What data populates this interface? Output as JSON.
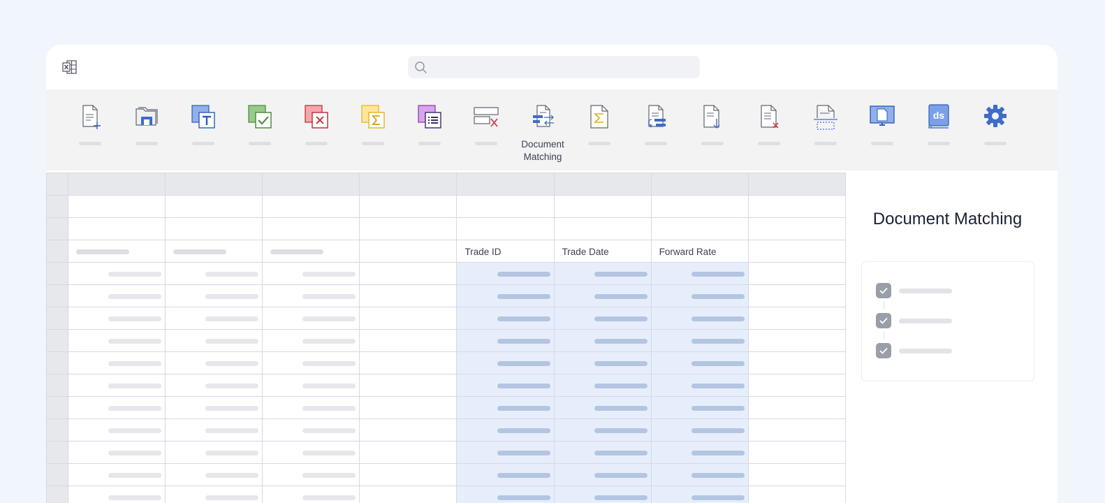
{
  "topbar": {
    "app_icon": "excel-icon",
    "search": {
      "placeholder": "",
      "value": "",
      "icon": "search-icon"
    }
  },
  "ribbon": {
    "items": [
      {
        "id": "new-document",
        "icon": "new-document-icon",
        "label": ""
      },
      {
        "id": "open-folder",
        "icon": "open-folder-icon",
        "label": ""
      },
      {
        "id": "text-template",
        "icon": "text-template-icon",
        "label": ""
      },
      {
        "id": "accept",
        "icon": "accept-check-icon",
        "label": ""
      },
      {
        "id": "reject",
        "icon": "reject-x-icon",
        "label": ""
      },
      {
        "id": "sum",
        "icon": "sigma-icon",
        "label": ""
      },
      {
        "id": "list",
        "icon": "list-icon",
        "label": ""
      },
      {
        "id": "remove-rows",
        "icon": "remove-rows-icon",
        "label": ""
      },
      {
        "id": "document-matching",
        "icon": "document-matching-icon",
        "label": "Document\nMatching"
      },
      {
        "id": "sum-document",
        "icon": "sigma-document-icon",
        "label": ""
      },
      {
        "id": "link-document",
        "icon": "link-document-icon",
        "label": ""
      },
      {
        "id": "download-document",
        "icon": "download-document-icon",
        "label": ""
      },
      {
        "id": "delete-document",
        "icon": "delete-document-icon",
        "label": ""
      },
      {
        "id": "page-break",
        "icon": "page-break-icon",
        "label": ""
      },
      {
        "id": "monitor",
        "icon": "monitor-document-icon",
        "label": ""
      },
      {
        "id": "ds-book",
        "icon": "ds-book-icon",
        "label": ""
      },
      {
        "id": "settings",
        "icon": "gear-icon",
        "label": ""
      }
    ]
  },
  "sheet": {
    "columns": [
      {
        "header": "",
        "placeholder": true
      },
      {
        "header": "",
        "placeholder": true
      },
      {
        "header": "",
        "placeholder": true
      },
      {
        "header": "",
        "placeholder": false
      },
      {
        "header": "Trade ID",
        "placeholder": false
      },
      {
        "header": "Trade Date",
        "placeholder": false
      },
      {
        "header": "Forward Rate",
        "placeholder": false
      },
      {
        "header": "",
        "placeholder": false
      }
    ],
    "highlight_color": "#e7eefb"
  },
  "panel": {
    "title": "Document Matching",
    "steps": [
      {
        "checked": true,
        "label": ""
      },
      {
        "checked": true,
        "label": ""
      },
      {
        "checked": true,
        "label": ""
      }
    ]
  },
  "colors": {
    "background": "#f1f6fd",
    "ribbon": "#f3f3f4",
    "grid_border": "#d4d9e7",
    "accent_blue": "#2e5cba"
  }
}
